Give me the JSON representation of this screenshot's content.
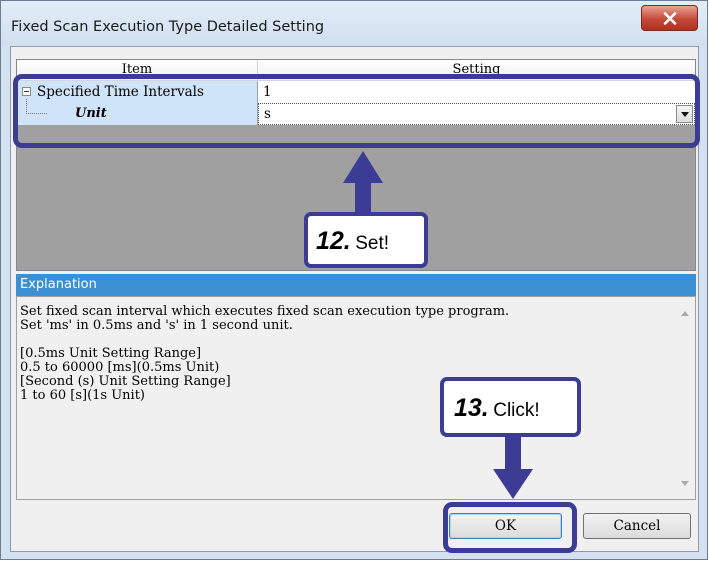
{
  "window": {
    "title": "Fixed Scan Execution Type Detailed Setting"
  },
  "grid": {
    "headers": {
      "item": "Item",
      "setting": "Setting"
    },
    "rows": [
      {
        "label": "Specified Time Intervals",
        "value": "1"
      },
      {
        "label": "Unit",
        "value": "s"
      }
    ]
  },
  "explanation": {
    "header": "Explanation",
    "lines": [
      "Set fixed scan interval which executes fixed scan execution type program.",
      "Set 'ms' in 0.5ms and 's' in 1 second unit.",
      "",
      "[0.5ms Unit Setting Range]",
      "0.5 to 60000 [ms](0.5ms Unit)",
      "[Second (s) Unit Setting Range]",
      "1 to 60 [s](1s Unit)"
    ]
  },
  "buttons": {
    "ok": "OK",
    "cancel": "Cancel"
  },
  "annotations": [
    {
      "num": "12.",
      "text": "Set!"
    },
    {
      "num": "13.",
      "text": "Click!"
    }
  ],
  "colors": {
    "annotation": "#3c3c94",
    "explanation_header": "#3b8fd3",
    "item_cell": "#cfe3f9"
  }
}
